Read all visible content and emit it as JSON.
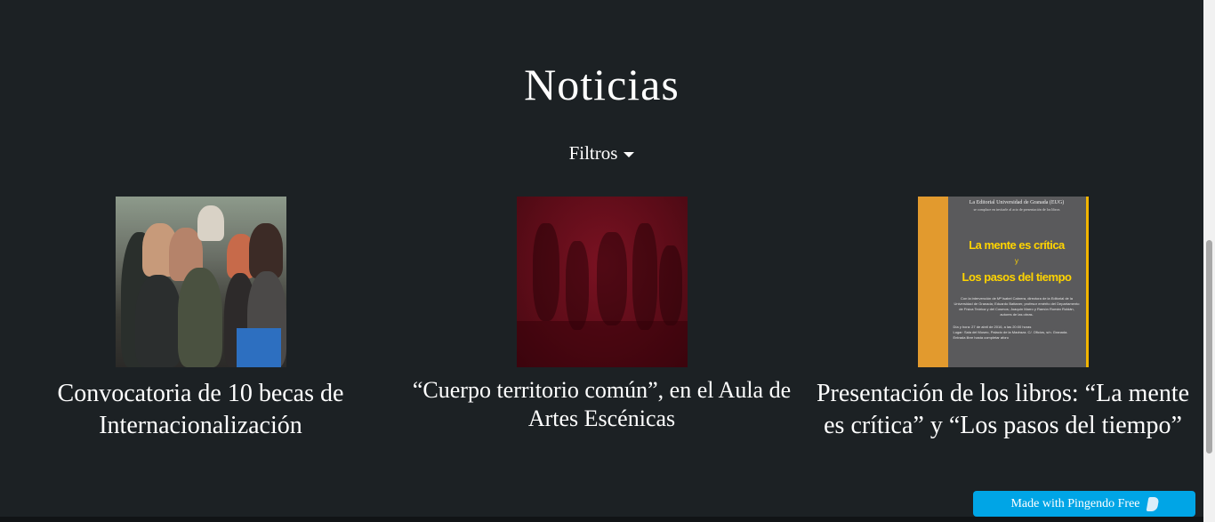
{
  "page": {
    "title": "Noticias",
    "filters_label": "Filtros"
  },
  "news": [
    {
      "title": "Convocatoria de 10 becas de Internacionalización",
      "image": "students-photo"
    },
    {
      "title": "“Cuerpo territorio común”, en el Aula de Artes Escénicas",
      "image": "dance-red-photo"
    },
    {
      "title": "Presentación de los libros: “La mente es crítica” y “Los pasos del tiempo”",
      "image": "book-presentation-poster"
    }
  ],
  "poster": {
    "header": "La Editorial Universidad de Granada (EUG)",
    "subheader": "se complace en invitarle al acto de presentación de los libros",
    "book1": "La mente es crítica",
    "conjunction": "y",
    "book2": "Los pasos del tiempo",
    "body": "Con la intervención de Mª Isabel Cabrera, directora de la Editorial de la Universidad de Granada; Eduardo Battaner, profesor emérito del Departamento de Física Teórica y del Cosmos; Joaquín Marro y Ramón Román Roldán, autores de las obras.",
    "when": "Día y hora: 27 de abril de 2016, a las 20:00 horas",
    "where": "Lugar: Sala del Museo, Palacio de la Madraza. C/. Oficios, s/n. Granada. Entrada libre hasta completar aforo",
    "cover1": "La mente es crítica",
    "cover2": "Los pasos del tiempo"
  },
  "footer_badge": {
    "label": "Made with Pingendo Free"
  },
  "colors": {
    "background": "#1c2124",
    "badge": "#00a5e6"
  }
}
